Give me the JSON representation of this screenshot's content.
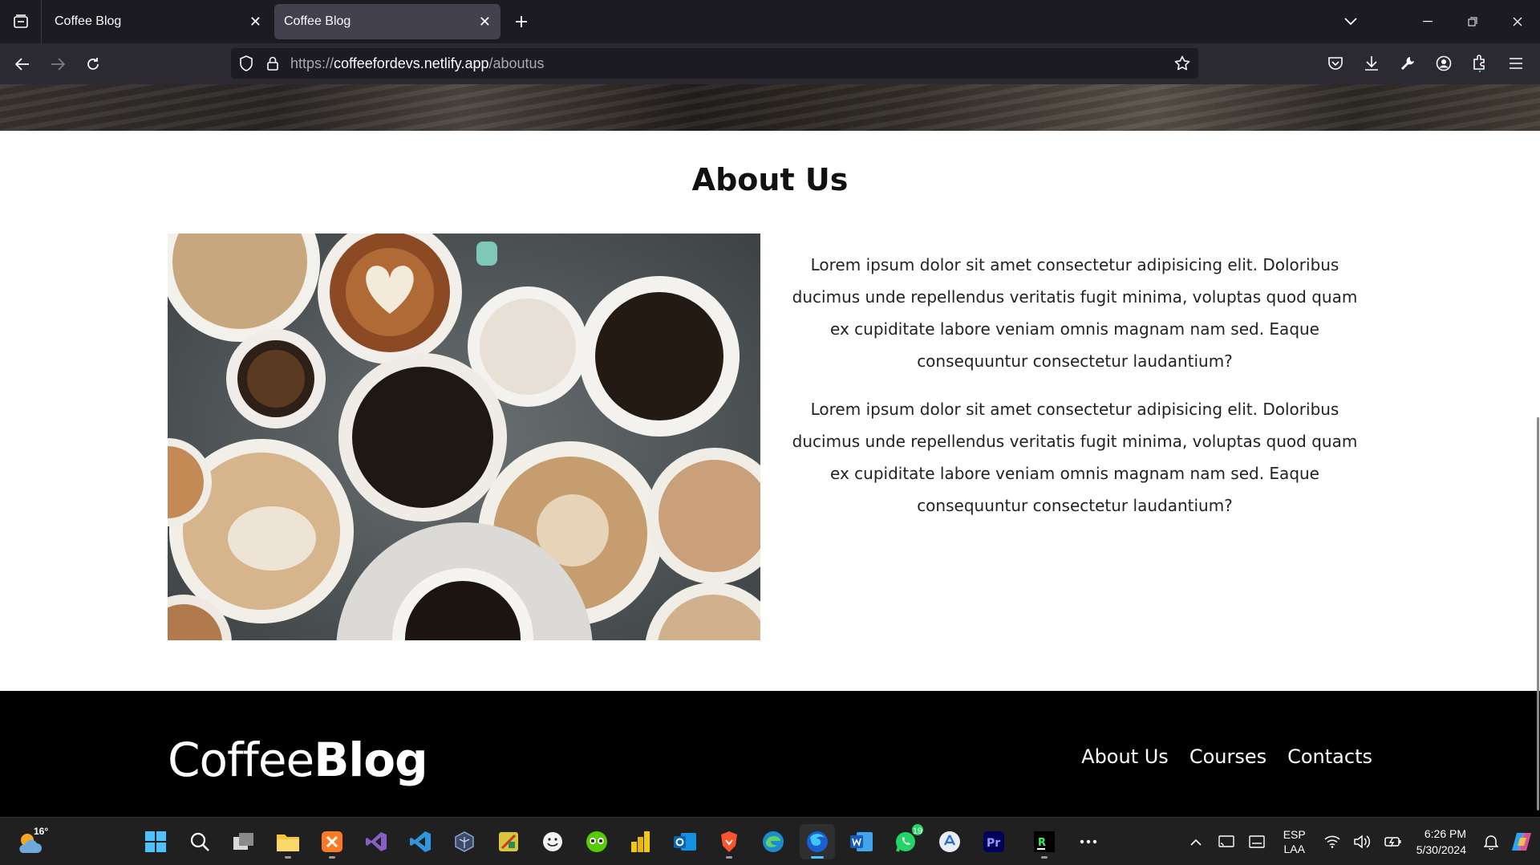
{
  "browser": {
    "tabs": [
      {
        "title": "Coffee Blog",
        "active": false
      },
      {
        "title": "Coffee Blog",
        "active": true
      }
    ],
    "url": {
      "prefix": "https://",
      "host": "coffeefordevs.netlify.app",
      "path": "/aboutus"
    }
  },
  "page": {
    "about": {
      "title": "About Us",
      "image_alt": "Assorted coffee cups viewed from above",
      "paragraphs": [
        "Lorem ipsum dolor sit amet consectetur adipisicing elit. Doloribus ducimus unde repellendus veritatis fugit minima, voluptas quod quam ex cupiditate labore veniam omnis magnam nam sed. Eaque consequuntur consectetur laudantium?",
        "Lorem ipsum dolor sit amet consectetur adipisicing elit. Doloribus ducimus unde repellendus veritatis fugit minima, voluptas quod quam ex cupiditate labore veniam omnis magnam nam sed. Eaque consequuntur consectetur laudantium?"
      ]
    },
    "footer": {
      "logo_light": "Coffee",
      "logo_bold": "Blog",
      "links": [
        "About Us",
        "Courses",
        "Contacts"
      ]
    }
  },
  "taskbar": {
    "weather_temp": "16°",
    "whatsapp_badge": "19",
    "language": {
      "line1": "ESP",
      "line2": "LAA"
    },
    "clock": {
      "time": "6:26 PM",
      "date": "5/30/2024"
    }
  }
}
